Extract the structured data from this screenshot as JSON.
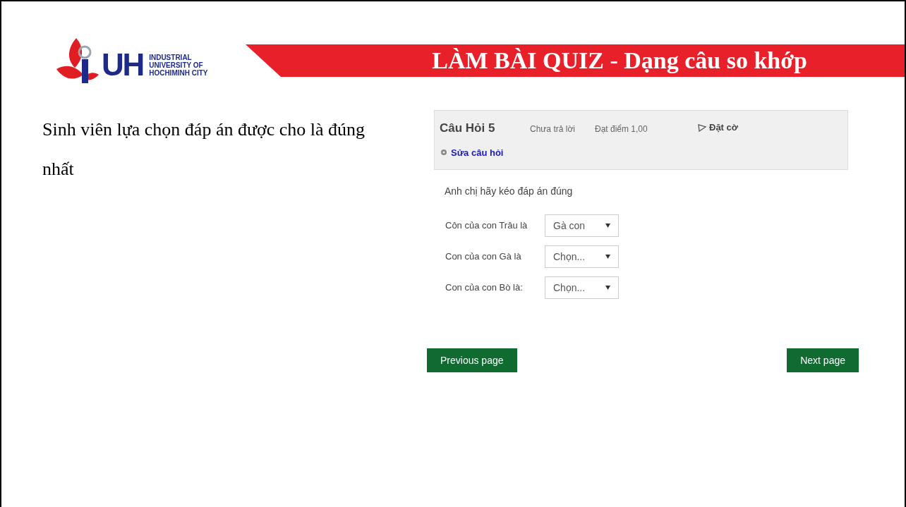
{
  "logo": {
    "mark": "UH",
    "lines": [
      "INDUSTRIAL",
      "UNIVERSITY OF",
      "HOCHIMINH CITY"
    ]
  },
  "banner": {
    "title": "LÀM BÀI QUIZ - Dạng câu so khớp"
  },
  "description": "Sinh viên lựa chọn đáp án được cho là đúng nhất",
  "quiz": {
    "question_title": "Câu Hỏi 5",
    "status": "Chưa trả lời",
    "grade": "Đạt điểm 1,00",
    "flag": {
      "label": "Đặt cờ",
      "flagged": false
    },
    "edit_link": "Sửa câu hỏi",
    "prompt": "Anh chị hãy kéo đáp án đúng",
    "items": [
      {
        "label": "Côn của con Trâu là",
        "value": "Gà con"
      },
      {
        "label": "Con của con Gà là",
        "value": "Chọn..."
      },
      {
        "label": "Con của con Bò là:",
        "value": "Chọn..."
      }
    ],
    "buttons": {
      "previous": "Previous page",
      "next": "Next page"
    }
  }
}
